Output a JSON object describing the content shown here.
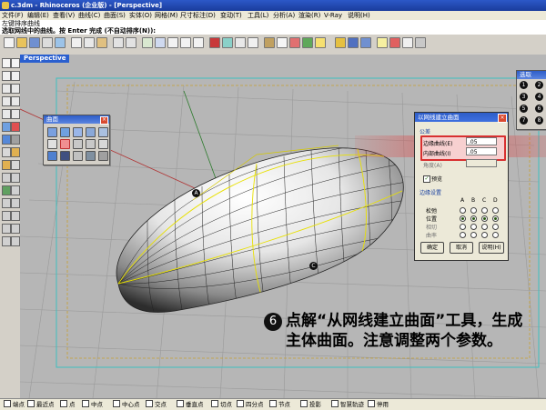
{
  "window": {
    "title": "c.3dm - Rhinoceros (企业版) - [Perspective]"
  },
  "menu": [
    "文件(F)",
    "编辑(E)",
    "查看(V)",
    "曲线(C)",
    "曲面(S)",
    "实体(O)",
    "网格(M)",
    "尺寸标注(D)",
    "变动(T)",
    "工具(L)",
    "分析(A)",
    "渲染(R)",
    "V-Ray",
    "说明(H)"
  ],
  "command": {
    "line1": "左键排序曲线",
    "line2": "选取网线中的曲线。按 Enter 完成 (不自动排序(N)):"
  },
  "viewport": {
    "tab": "Perspective"
  },
  "surface_panel": {
    "title": "曲面"
  },
  "point_panel": {
    "title": "选取",
    "numbers": [
      "1",
      "2",
      "3",
      "4",
      "5",
      "6",
      "7",
      "8",
      "9",
      "0"
    ]
  },
  "dialog": {
    "title": "以网线建立曲面",
    "group_tolerance": "公差",
    "edge_label": "边缘曲线(E)",
    "edge_value": ".05",
    "inner_label": "内部曲线(I)",
    "inner_value": ".05",
    "angle_label": "角度(A)",
    "preview_label": "预览",
    "group_edge": "边缘设置",
    "col_a": "A",
    "col_b": "B",
    "col_c": "C",
    "col_d": "D",
    "row_loose": "松弛",
    "row_position": "位置",
    "row_tangent": "相切",
    "row_curvature": "曲率",
    "ok": "确定",
    "cancel": "取消",
    "help": "说明(H)"
  },
  "labels": {
    "a": "A",
    "c": "C"
  },
  "caption": {
    "number": "6",
    "text": "点解“从网线建立曲面”工具，生成主体曲面。注意调整两个参数。"
  },
  "status": [
    "端点",
    "最近点",
    "点",
    "中点",
    "中心点",
    "交点",
    "垂直点",
    "切点",
    "四分点",
    "节点",
    "投影",
    "智慧轨迹",
    "停用"
  ],
  "colors": {
    "title": "#1a3c9c",
    "viewport": "#b6b6b6",
    "highlight": "#e03020"
  }
}
